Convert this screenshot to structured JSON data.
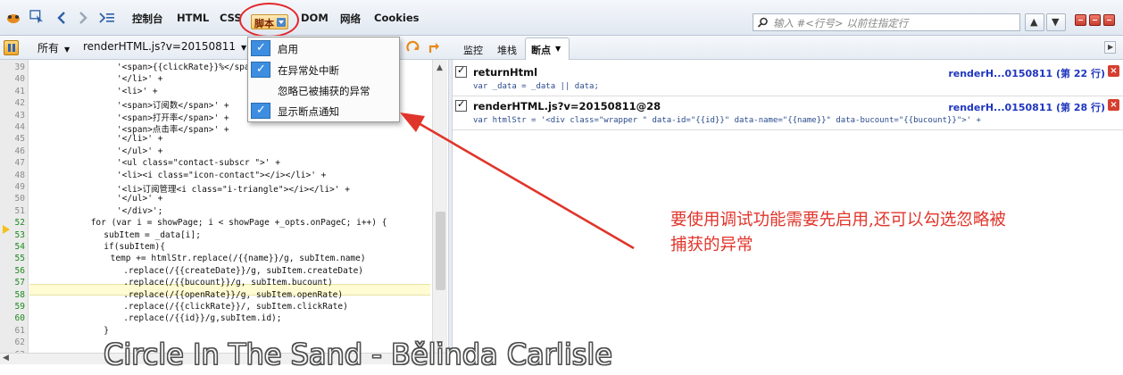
{
  "toolbar": {
    "tabs": [
      "控制台",
      "HTML",
      "CSS",
      "DOM",
      "网络",
      "Cookies"
    ],
    "active_tab": "脚本",
    "search_placeholder": "输入 #<行号> 以前往指定行"
  },
  "debug_bar": {
    "filter": "所有",
    "file": "renderHTML.js?v=20150811",
    "panel_tabs": [
      "监控",
      "堆栈",
      "断点"
    ]
  },
  "menu": {
    "items": [
      {
        "label": "启用",
        "checked": true
      },
      {
        "label": "在异常处中断",
        "checked": true
      },
      {
        "label": "忽略已被捕获的异常",
        "checked": false
      },
      {
        "label": "显示断点通知",
        "checked": true
      }
    ]
  },
  "code": {
    "current_line": 53,
    "lines": [
      {
        "n": "39",
        "text": "'<span>{{clickRate}}%</span>' +"
      },
      {
        "n": "40",
        "text": "'</li>' +"
      },
      {
        "n": "41",
        "text": "'<li>' +"
      },
      {
        "n": "42",
        "text": "'<span>订阅数</span>' +"
      },
      {
        "n": "43",
        "text": "'<span>打开率</span>' +"
      },
      {
        "n": "44",
        "text": "'<span>点击率</span>' +"
      },
      {
        "n": "45",
        "text": "'</li>' +"
      },
      {
        "n": "46",
        "text": "'</ul>' +"
      },
      {
        "n": "47",
        "text": "'<ul class=\"contact-subscr \">' +"
      },
      {
        "n": "48",
        "text": "'<li><i class=\"icon-contact\"></i></li>' +"
      },
      {
        "n": "49",
        "text": "'<li>订阅管理<i class=\"i-triangle\"></i></li>' +"
      },
      {
        "n": "50",
        "text": "'</ul>' +"
      },
      {
        "n": "51",
        "text": "'</div>';"
      },
      {
        "n": "52",
        "text": "for (var i = showPage; i < showPage +_opts.onPageC; i++) {"
      },
      {
        "n": "53",
        "text": "subItem = _data[i];"
      },
      {
        "n": "54",
        "text": "if(subItem){"
      },
      {
        "n": "55",
        "text": "temp += htmlStr.replace(/{{name}}/g, subItem.name)"
      },
      {
        "n": "56",
        "text": ".replace(/{{createDate}}/g, subItem.createDate)"
      },
      {
        "n": "57",
        "text": ".replace(/{{bucount}}/g, subItem.bucount)"
      },
      {
        "n": "58",
        "text": ".replace(/{{openRate}}/g, subItem.openRate)"
      },
      {
        "n": "59",
        "text": ".replace(/{{clickRate}}/, subItem.clickRate)"
      },
      {
        "n": "60",
        "text": ".replace(/{{id}}/g,subItem.id);"
      },
      {
        "n": "61",
        "text": "}"
      },
      {
        "n": "62",
        "text": ""
      },
      {
        "n": "63",
        "text": ""
      }
    ]
  },
  "breakpoints": [
    {
      "name": "returnHtml",
      "location": "renderH...0150811 (第 22 行)",
      "source": "var _data = _data || data;"
    },
    {
      "name": "renderHTML.js?v=20150811@28",
      "location": "renderH...0150811 (第 28 行)",
      "source": "var htmlStr = '<div class=\"wrapper \" data-id=\"{{id}}\" data-name=\"{{name}}\" data-bucount=\"{{bucount}}\">' +"
    }
  ],
  "annotation": {
    "line1": "要使用调试功能需要先启用,还可以勾选忽略被",
    "line2": "捕获的异常",
    "color": "#e0352b"
  },
  "caption": "Circle In The Sand - Bělinda Carlisle"
}
